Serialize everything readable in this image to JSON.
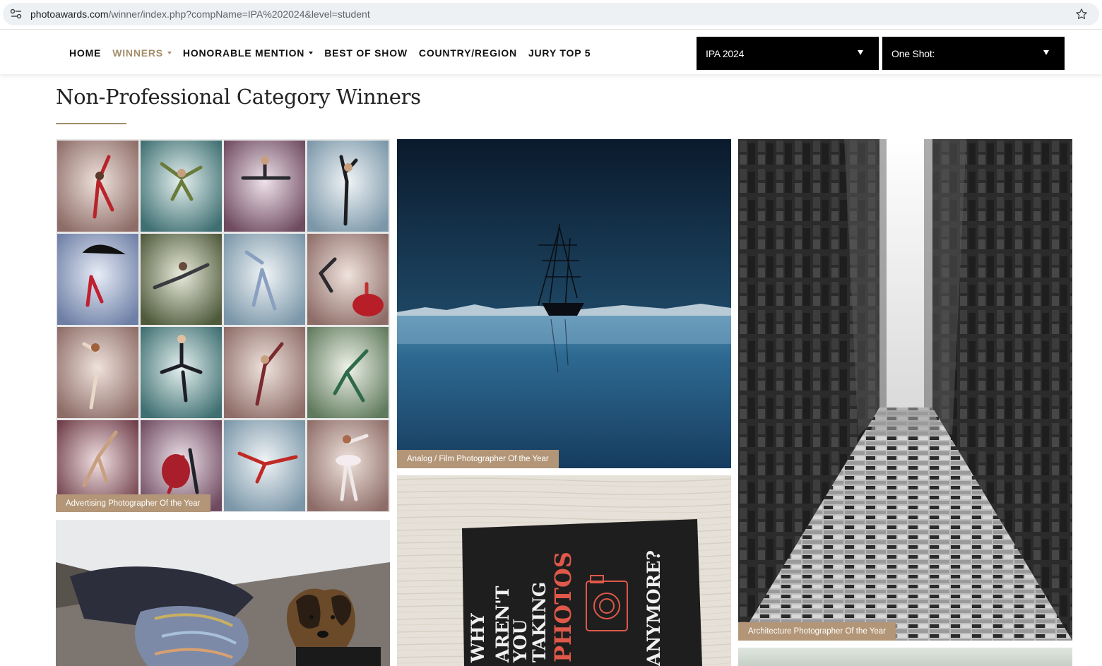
{
  "browser": {
    "url_host": "photoawards.com",
    "url_path": "/winner/index.php?compName=IPA%202024&level=student"
  },
  "nav": {
    "items": [
      {
        "label": "HOME",
        "active": false,
        "has_caret": false
      },
      {
        "label": "WINNERS",
        "active": true,
        "has_caret": true
      },
      {
        "label": "HONORABLE MENTION",
        "active": false,
        "has_caret": true
      },
      {
        "label": "BEST OF SHOW",
        "active": false,
        "has_caret": false
      },
      {
        "label": "COUNTRY/REGION",
        "active": false,
        "has_caret": false
      },
      {
        "label": "JURY TOP 5",
        "active": false,
        "has_caret": false
      }
    ],
    "active_color": "#a48d6b"
  },
  "filters": {
    "competition": "IPA 2024",
    "shot": "One Shot:"
  },
  "page": {
    "title": "Non-Professional Category Winners",
    "accent": "#a48d6b"
  },
  "gallery": {
    "caption_color": "#b39677",
    "cards": [
      {
        "id": "advertising",
        "caption": "Advertising Photographer Of the Year"
      },
      {
        "id": "analog",
        "caption": "Analog / Film Photographer Of the Year"
      },
      {
        "id": "architecture",
        "caption": "Architecture Photographer Of the Year"
      },
      {
        "id": "dog",
        "caption": ""
      },
      {
        "id": "sign",
        "caption": ""
      },
      {
        "id": "partial",
        "caption": ""
      }
    ],
    "sign_text": [
      "WHY",
      "AREN'T",
      "YOU",
      "TAKING",
      "PHOTOS",
      "ANYMORE?"
    ]
  }
}
